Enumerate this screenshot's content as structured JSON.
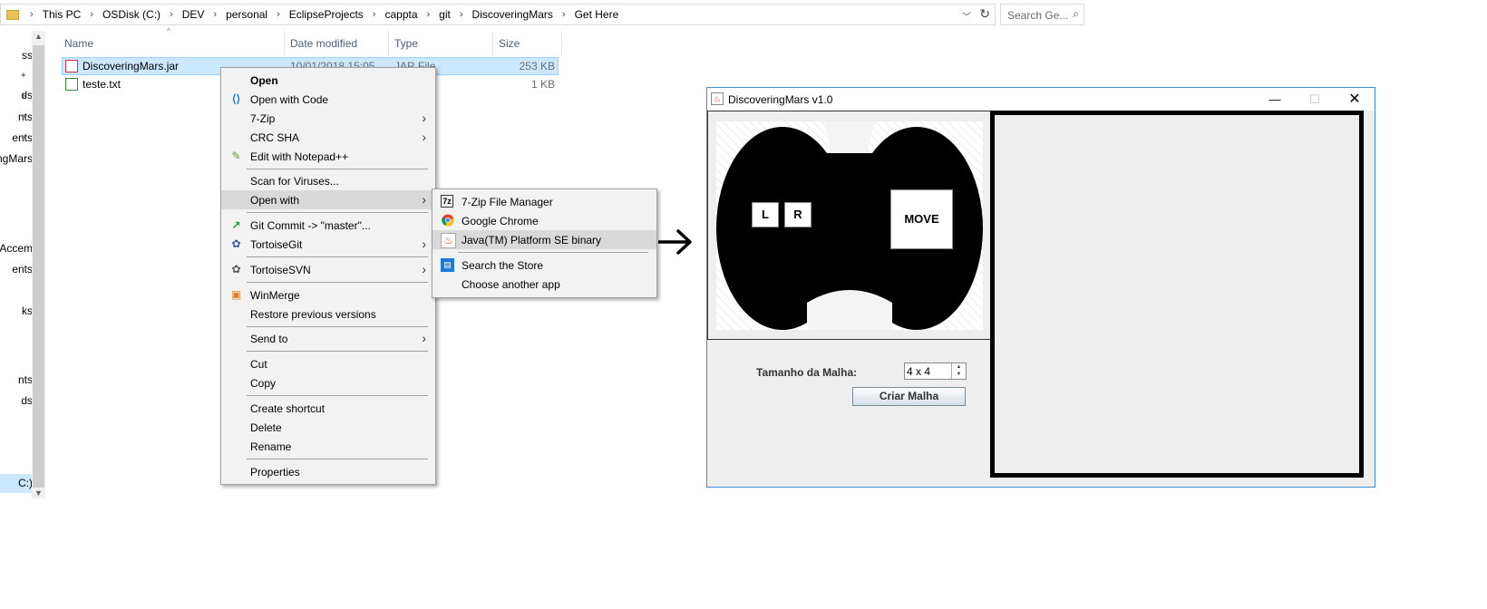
{
  "explorer": {
    "breadcrumb": [
      "This PC",
      "OSDisk (C:)",
      "DEV",
      "personal",
      "EclipseProjects",
      "cappta",
      "git",
      "DiscoveringMars",
      "Get Here"
    ],
    "search_placeholder": "Search Ge...",
    "nav_items": [
      "ss",
      "ds",
      "nts",
      "ents",
      "ingMars",
      "Accem",
      "ents",
      "ks",
      "nts",
      "ds",
      "C:)"
    ],
    "columns": {
      "name": "Name",
      "date": "Date modified",
      "type": "Type",
      "size": "Size"
    },
    "files": [
      {
        "name": "DiscoveringMars.jar",
        "date": "10/01/2018 15:05",
        "type": "JAR File",
        "size": "253 KB"
      },
      {
        "name": "teste.txt",
        "date": "",
        "type": "",
        "size": "1 KB"
      }
    ]
  },
  "context_menu": {
    "open": "Open",
    "open_with_code": "Open with Code",
    "seven_zip": "7-Zip",
    "crc_sha": "CRC SHA",
    "edit_notepad": "Edit with Notepad++",
    "scan": "Scan for Viruses...",
    "open_with": "Open with",
    "git_commit": "Git Commit -> \"master\"...",
    "tortoisegit": "TortoiseGit",
    "tortoisesvn": "TortoiseSVN",
    "winmerge": "WinMerge",
    "restore": "Restore previous versions",
    "send_to": "Send to",
    "cut": "Cut",
    "copy": "Copy",
    "create_shortcut": "Create shortcut",
    "delete": "Delete",
    "rename": "Rename",
    "properties": "Properties"
  },
  "submenu": {
    "zip_manager": "7-Zip File Manager",
    "chrome": "Google Chrome",
    "java": "Java(TM) Platform SE binary",
    "store": "Search the Store",
    "choose": "Choose another app"
  },
  "java_window": {
    "title": "DiscoveringMars v1.0",
    "btn_l": "L",
    "btn_r": "R",
    "btn_move": "MOVE",
    "tamanho_label": "Tamanho da Malha:",
    "tamanho_value": "4 x 4",
    "criar_button": "Criar Malha"
  }
}
